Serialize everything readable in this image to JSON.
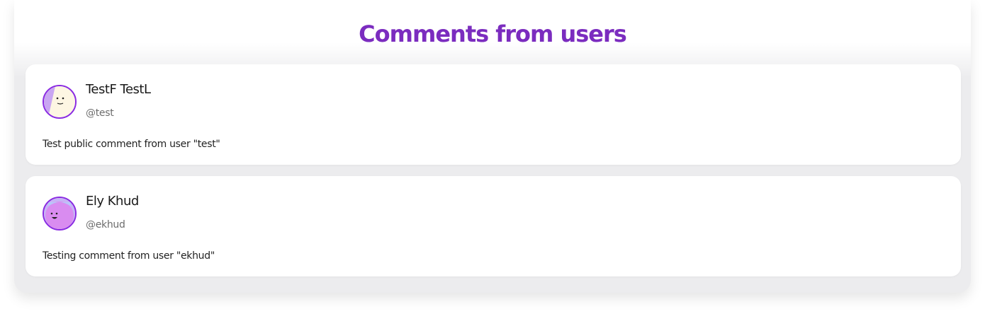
{
  "header": {
    "title": "Comments from users"
  },
  "colors": {
    "accent": "#7b2cbf",
    "avatar_border": "#8a2be2"
  },
  "comments": [
    {
      "name": "TestF TestL",
      "handle": "@test",
      "text": "Test public comment from user \"test\"",
      "avatar_icon": "neutral-face-avatar-icon"
    },
    {
      "name": "Ely Khud",
      "handle": "@ekhud",
      "text": "Testing comment from user \"ekhud\"",
      "avatar_icon": "smiling-face-avatar-icon"
    }
  ]
}
